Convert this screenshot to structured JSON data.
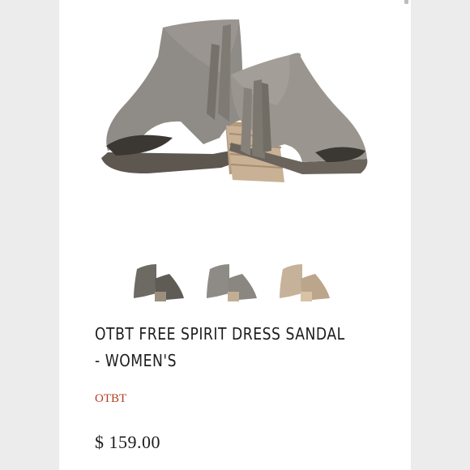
{
  "product": {
    "title": "OTBT FREE SPIRIT DRESS SANDAL - WOMEN'S",
    "brand": "OTBT",
    "price": "$ 159.00"
  },
  "images": {
    "main": "taupe-fringe-peep-toe-bootie-pair",
    "thumbnails": [
      {
        "color_name": "charcoal",
        "color": "#6d6a64"
      },
      {
        "color_name": "grey",
        "color": "#8e8b86"
      },
      {
        "color_name": "tan",
        "color": "#c6b29a"
      }
    ]
  },
  "colors": {
    "brand_accent": "#b33d21",
    "text": "#1d1d1d",
    "background": "#ffffff",
    "side_margin": "#ececec"
  }
}
